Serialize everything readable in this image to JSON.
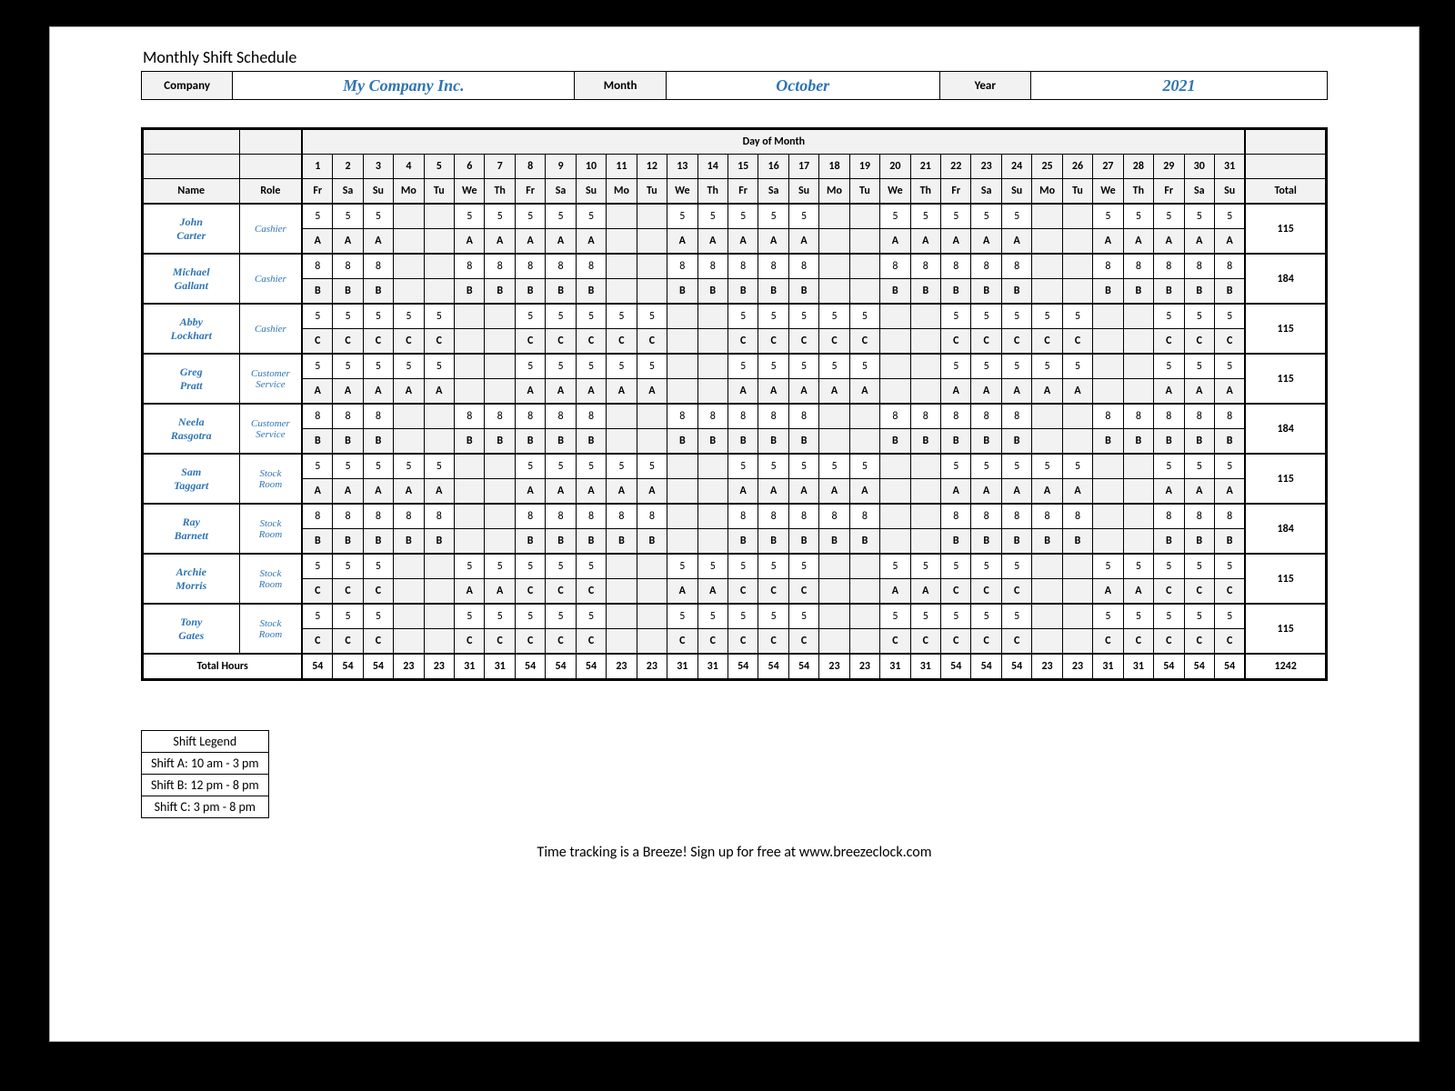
{
  "title": "Monthly Shift Schedule",
  "header": {
    "company_label": "Company",
    "company_value": "My Company Inc.",
    "month_label": "Month",
    "month_value": "October",
    "year_label": "Year",
    "year_value": "2021"
  },
  "columns": {
    "day_of_month_label": "Day of Month",
    "name_label": "Name",
    "role_label": "Role",
    "total_label": "Total",
    "days": [
      "1",
      "2",
      "3",
      "4",
      "5",
      "6",
      "7",
      "8",
      "9",
      "10",
      "11",
      "12",
      "13",
      "14",
      "15",
      "16",
      "17",
      "18",
      "19",
      "20",
      "21",
      "22",
      "23",
      "24",
      "25",
      "26",
      "27",
      "28",
      "29",
      "30",
      "31"
    ],
    "dows": [
      "Fr",
      "Sa",
      "Su",
      "Mo",
      "Tu",
      "We",
      "Th",
      "Fr",
      "Sa",
      "Su",
      "Mo",
      "Tu",
      "We",
      "Th",
      "Fr",
      "Sa",
      "Su",
      "Mo",
      "Tu",
      "We",
      "Th",
      "Fr",
      "Sa",
      "Su",
      "Mo",
      "Tu",
      "We",
      "Th",
      "Fr",
      "Sa",
      "Su"
    ]
  },
  "employees": [
    {
      "name": "John Carter",
      "role": "Cashier",
      "hours": [
        "5",
        "5",
        "5",
        "",
        "",
        "5",
        "5",
        "5",
        "5",
        "5",
        "",
        "",
        "5",
        "5",
        "5",
        "5",
        "5",
        "",
        "",
        "5",
        "5",
        "5",
        "5",
        "5",
        "",
        "",
        "5",
        "5",
        "5",
        "5",
        "5"
      ],
      "shifts": [
        "A",
        "A",
        "A",
        "",
        "",
        "A",
        "A",
        "A",
        "A",
        "A",
        "",
        "",
        "A",
        "A",
        "A",
        "A",
        "A",
        "",
        "",
        "A",
        "A",
        "A",
        "A",
        "A",
        "",
        "",
        "A",
        "A",
        "A",
        "A",
        "A"
      ],
      "total": "115"
    },
    {
      "name": "Michael Gallant",
      "role": "Cashier",
      "hours": [
        "8",
        "8",
        "8",
        "",
        "",
        "8",
        "8",
        "8",
        "8",
        "8",
        "",
        "",
        "8",
        "8",
        "8",
        "8",
        "8",
        "",
        "",
        "8",
        "8",
        "8",
        "8",
        "8",
        "",
        "",
        "8",
        "8",
        "8",
        "8",
        "8"
      ],
      "shifts": [
        "B",
        "B",
        "B",
        "",
        "",
        "B",
        "B",
        "B",
        "B",
        "B",
        "",
        "",
        "B",
        "B",
        "B",
        "B",
        "B",
        "",
        "",
        "B",
        "B",
        "B",
        "B",
        "B",
        "",
        "",
        "B",
        "B",
        "B",
        "B",
        "B"
      ],
      "total": "184"
    },
    {
      "name": "Abby Lockhart",
      "role": "Cashier",
      "hours": [
        "5",
        "5",
        "5",
        "5",
        "5",
        "",
        "",
        "5",
        "5",
        "5",
        "5",
        "5",
        "",
        "",
        "5",
        "5",
        "5",
        "5",
        "5",
        "",
        "",
        "5",
        "5",
        "5",
        "5",
        "5",
        "",
        "",
        "5",
        "5",
        "5"
      ],
      "shifts": [
        "C",
        "C",
        "C",
        "C",
        "C",
        "",
        "",
        "C",
        "C",
        "C",
        "C",
        "C",
        "",
        "",
        "C",
        "C",
        "C",
        "C",
        "C",
        "",
        "",
        "C",
        "C",
        "C",
        "C",
        "C",
        "",
        "",
        "C",
        "C",
        "C"
      ],
      "total": "115"
    },
    {
      "name": "Greg Pratt",
      "role": "Customer Service",
      "hours": [
        "5",
        "5",
        "5",
        "5",
        "5",
        "",
        "",
        "5",
        "5",
        "5",
        "5",
        "5",
        "",
        "",
        "5",
        "5",
        "5",
        "5",
        "5",
        "",
        "",
        "5",
        "5",
        "5",
        "5",
        "5",
        "",
        "",
        "5",
        "5",
        "5"
      ],
      "shifts": [
        "A",
        "A",
        "A",
        "A",
        "A",
        "",
        "",
        "A",
        "A",
        "A",
        "A",
        "A",
        "",
        "",
        "A",
        "A",
        "A",
        "A",
        "A",
        "",
        "",
        "A",
        "A",
        "A",
        "A",
        "A",
        "",
        "",
        "A",
        "A",
        "A"
      ],
      "total": "115"
    },
    {
      "name": "Neela Rasgotra",
      "role": "Customer Service",
      "hours": [
        "8",
        "8",
        "8",
        "",
        "",
        "8",
        "8",
        "8",
        "8",
        "8",
        "",
        "",
        "8",
        "8",
        "8",
        "8",
        "8",
        "",
        "",
        "8",
        "8",
        "8",
        "8",
        "8",
        "",
        "",
        "8",
        "8",
        "8",
        "8",
        "8"
      ],
      "shifts": [
        "B",
        "B",
        "B",
        "",
        "",
        "B",
        "B",
        "B",
        "B",
        "B",
        "",
        "",
        "B",
        "B",
        "B",
        "B",
        "B",
        "",
        "",
        "B",
        "B",
        "B",
        "B",
        "B",
        "",
        "",
        "B",
        "B",
        "B",
        "B",
        "B"
      ],
      "total": "184"
    },
    {
      "name": "Sam Taggart",
      "role": "Stock Room",
      "hours": [
        "5",
        "5",
        "5",
        "5",
        "5",
        "",
        "",
        "5",
        "5",
        "5",
        "5",
        "5",
        "",
        "",
        "5",
        "5",
        "5",
        "5",
        "5",
        "",
        "",
        "5",
        "5",
        "5",
        "5",
        "5",
        "",
        "",
        "5",
        "5",
        "5"
      ],
      "shifts": [
        "A",
        "A",
        "A",
        "A",
        "A",
        "",
        "",
        "A",
        "A",
        "A",
        "A",
        "A",
        "",
        "",
        "A",
        "A",
        "A",
        "A",
        "A",
        "",
        "",
        "A",
        "A",
        "A",
        "A",
        "A",
        "",
        "",
        "A",
        "A",
        "A"
      ],
      "total": "115"
    },
    {
      "name": "Ray Barnett",
      "role": "Stock Room",
      "hours": [
        "8",
        "8",
        "8",
        "8",
        "8",
        "",
        "",
        "8",
        "8",
        "8",
        "8",
        "8",
        "",
        "",
        "8",
        "8",
        "8",
        "8",
        "8",
        "",
        "",
        "8",
        "8",
        "8",
        "8",
        "8",
        "",
        "",
        "8",
        "8",
        "8"
      ],
      "shifts": [
        "B",
        "B",
        "B",
        "B",
        "B",
        "",
        "",
        "B",
        "B",
        "B",
        "B",
        "B",
        "",
        "",
        "B",
        "B",
        "B",
        "B",
        "B",
        "",
        "",
        "B",
        "B",
        "B",
        "B",
        "B",
        "",
        "",
        "B",
        "B",
        "B"
      ],
      "total": "184"
    },
    {
      "name": "Archie Morris",
      "role": "Stock Room",
      "hours": [
        "5",
        "5",
        "5",
        "",
        "",
        "5",
        "5",
        "5",
        "5",
        "5",
        "",
        "",
        "5",
        "5",
        "5",
        "5",
        "5",
        "",
        "",
        "5",
        "5",
        "5",
        "5",
        "5",
        "",
        "",
        "5",
        "5",
        "5",
        "5",
        "5"
      ],
      "shifts": [
        "C",
        "C",
        "C",
        "",
        "",
        "A",
        "A",
        "C",
        "C",
        "C",
        "",
        "",
        "A",
        "A",
        "C",
        "C",
        "C",
        "",
        "",
        "A",
        "A",
        "C",
        "C",
        "C",
        "",
        "",
        "A",
        "A",
        "C",
        "C",
        "C"
      ],
      "total": "115"
    },
    {
      "name": "Tony Gates",
      "role": "Stock Room",
      "hours": [
        "5",
        "5",
        "5",
        "",
        "",
        "5",
        "5",
        "5",
        "5",
        "5",
        "",
        "",
        "5",
        "5",
        "5",
        "5",
        "5",
        "",
        "",
        "5",
        "5",
        "5",
        "5",
        "5",
        "",
        "",
        "5",
        "5",
        "5",
        "5",
        "5"
      ],
      "shifts": [
        "C",
        "C",
        "C",
        "",
        "",
        "C",
        "C",
        "C",
        "C",
        "C",
        "",
        "",
        "C",
        "C",
        "C",
        "C",
        "C",
        "",
        "",
        "C",
        "C",
        "C",
        "C",
        "C",
        "",
        "",
        "C",
        "C",
        "C",
        "C",
        "C"
      ],
      "total": "115"
    }
  ],
  "totals": {
    "label": "Total Hours",
    "per_day": [
      "54",
      "54",
      "54",
      "23",
      "23",
      "31",
      "31",
      "54",
      "54",
      "54",
      "23",
      "23",
      "31",
      "31",
      "54",
      "54",
      "54",
      "23",
      "23",
      "31",
      "31",
      "54",
      "54",
      "54",
      "23",
      "23",
      "31",
      "31",
      "54",
      "54",
      "54"
    ],
    "grand": "1242"
  },
  "legend": {
    "title": "Shift Legend",
    "rows": [
      "Shift A: 10 am - 3 pm",
      "Shift B: 12 pm - 8 pm",
      "Shift C: 3 pm - 8 pm"
    ]
  },
  "footer": "Time tracking is a Breeze! Sign up for free at www.breezeclock.com"
}
